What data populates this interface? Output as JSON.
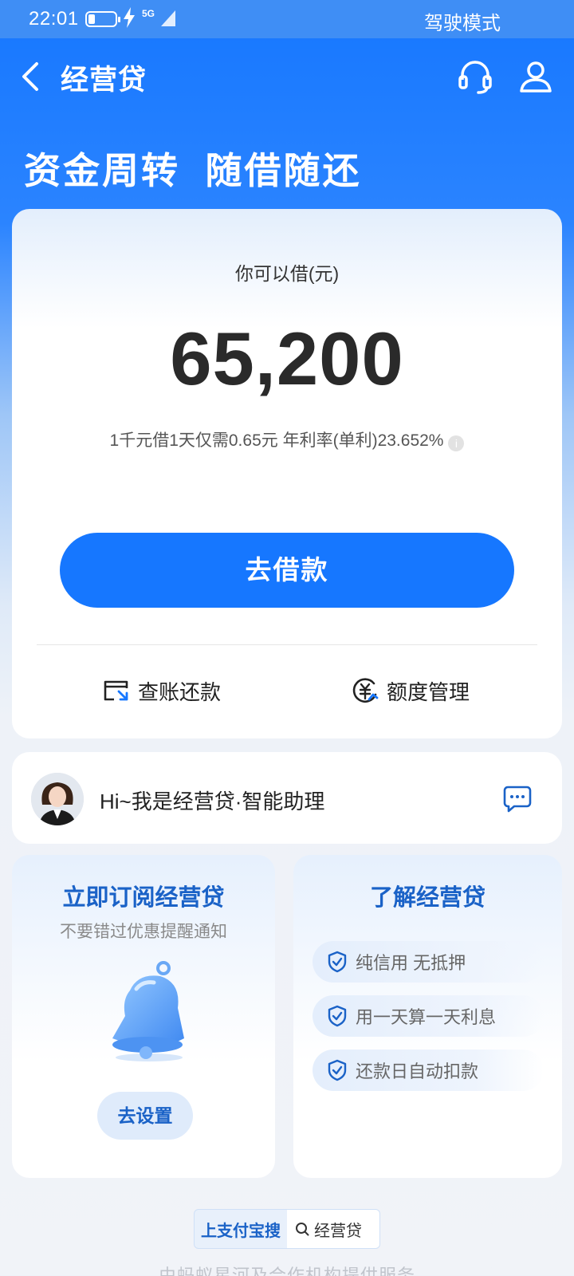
{
  "status_bar": {
    "time": "22:01",
    "network": "5G",
    "mode": "驾驶模式"
  },
  "header": {
    "title": "经营贷",
    "back_icon": "chevron-left-icon",
    "service_icon": "headset-icon",
    "profile_icon": "user-icon"
  },
  "slogan": "资金周转  随借随还",
  "loan_card": {
    "label": "你可以借(元)",
    "amount": "65,200",
    "rate_text": "1千元借1天仅需0.65元 年利率(单利)23.652%",
    "info_icon": "i",
    "borrow_button": "去借款",
    "actions": [
      {
        "label": "查账还款",
        "icon": "bill-icon"
      },
      {
        "label": "额度管理",
        "icon": "yuan-circle-icon"
      }
    ]
  },
  "assistant": {
    "text": "Hi~我是经营贷·智能助理",
    "icon": "chat-icon"
  },
  "subscribe_card": {
    "title": "立即订阅经营贷",
    "subtitle": "不要错过优惠提醒通知",
    "button": "去设置",
    "icon": "bell-icon"
  },
  "learn_card": {
    "title": "了解经营贷",
    "features": [
      "纯信用 无抵押",
      "用一天算一天利息",
      "还款日自动扣款"
    ],
    "icon": "shield-check-icon"
  },
  "footer": {
    "search_prefix": "上支付宝搜",
    "search_keyword": "经营贷",
    "note": "由蚂蚁星河及合作机构提供服务"
  },
  "colors": {
    "primary": "#1677ff",
    "title_blue": "#1a62c7"
  }
}
